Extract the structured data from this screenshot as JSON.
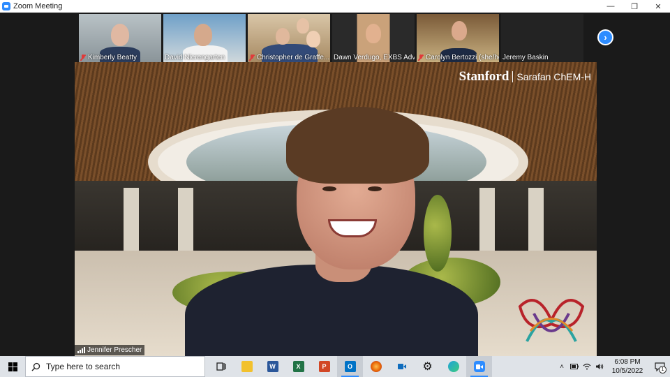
{
  "window": {
    "title": "Zoom Meeting"
  },
  "participants": [
    {
      "name": "Kimberly Beatty",
      "muted": true
    },
    {
      "name": "David Nierengarten",
      "muted": false
    },
    {
      "name": "Christopher de Graffe...",
      "muted": true
    },
    {
      "name": "Dawn Verdugo, EXBS Advi...",
      "muted": false
    },
    {
      "name": "Carolyn Bertozzi (she/her)",
      "muted": true
    },
    {
      "name": "Jeremy Baskin",
      "muted": false
    }
  ],
  "speaker": {
    "name": "Jennifer Prescher"
  },
  "background": {
    "brand": "Stanford",
    "unit": "Sarafan ChEM-H"
  },
  "taskbar": {
    "search_placeholder": "Type here to search",
    "apps": [
      "task-view",
      "file-explorer",
      "word",
      "excel",
      "powerpoint",
      "outlook",
      "firefox",
      "teams-meet",
      "settings",
      "edge",
      "zoom"
    ],
    "word_letter": "W",
    "excel_letter": "X",
    "powerpoint_letter": "P",
    "outlook_letter": "O",
    "time": "6:08 PM",
    "date": "10/5/2022",
    "notification_count": "1"
  },
  "colors": {
    "zoom_blue": "#2D8CFF",
    "mute_red": "#e03a3a"
  }
}
